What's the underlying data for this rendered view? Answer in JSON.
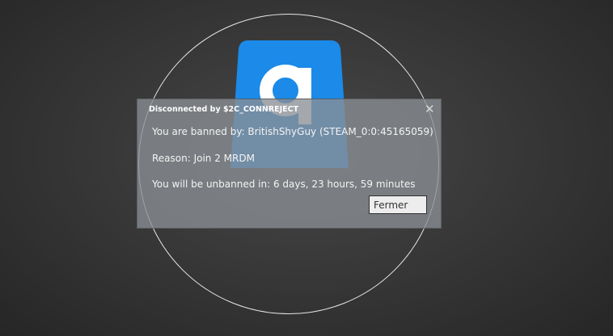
{
  "logo": {
    "letter": "g",
    "icon": "garrysmod-logo-icon",
    "color": "#1b8ae8"
  },
  "dialog": {
    "title": "Disconnected by $2C_CONNREJECT",
    "close_icon": "close-icon",
    "close_glyph": "✕",
    "ban_line": "You are banned by: BritishShyGuy (STEAM_0:0:45165059)",
    "reason_line": "Reason: Join 2 MRDM",
    "duration_line": "You will be unbanned in: 6 days, 23 hours, 59 minutes",
    "button_label": "Fermer"
  }
}
